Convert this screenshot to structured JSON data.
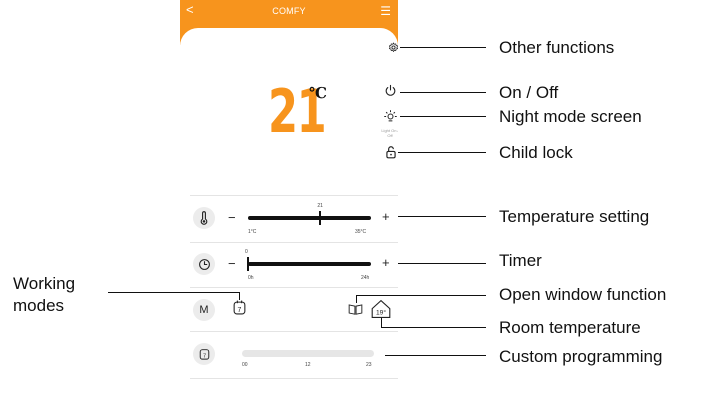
{
  "app": {
    "title": "COMFY",
    "back_glyph": "<",
    "menu_glyph": "☰"
  },
  "display": {
    "temperature": "21",
    "unit": "℃",
    "night_sub": "Light On / Off"
  },
  "temperature_slider": {
    "current": "21",
    "min": "1°C",
    "max": "35°C",
    "value": 21,
    "range": [
      1,
      35
    ]
  },
  "timer_slider": {
    "current": "0",
    "min": "0h",
    "max": "24h",
    "value": 0,
    "range": [
      0,
      24
    ]
  },
  "modes": {
    "button": "M",
    "mode_icon": "7",
    "room_temp": "19°"
  },
  "program": {
    "icon": "7",
    "ticks": [
      "00",
      "12",
      "23"
    ]
  },
  "callouts": {
    "other_functions": "Other functions",
    "on_off": "On / Off",
    "night_mode": "Night mode screen",
    "child_lock": "Child lock",
    "temp_setting": "Temperature setting",
    "timer": "Timer",
    "working_modes_1": "Working",
    "working_modes_2": "modes",
    "open_window": "Open window function",
    "room_temp": "Room temperature",
    "custom_programming": "Custom programming"
  },
  "icons": {
    "gear": "gear-icon",
    "power": "power-icon",
    "bulb": "bulb-icon",
    "lock": "lock-icon",
    "thermometer": "thermometer-icon",
    "clock": "clock-icon",
    "window": "window-icon",
    "house": "house-icon"
  },
  "colors": {
    "accent": "#f7941d",
    "divider": "#e4e4e4",
    "button_bg": "#ececec"
  }
}
